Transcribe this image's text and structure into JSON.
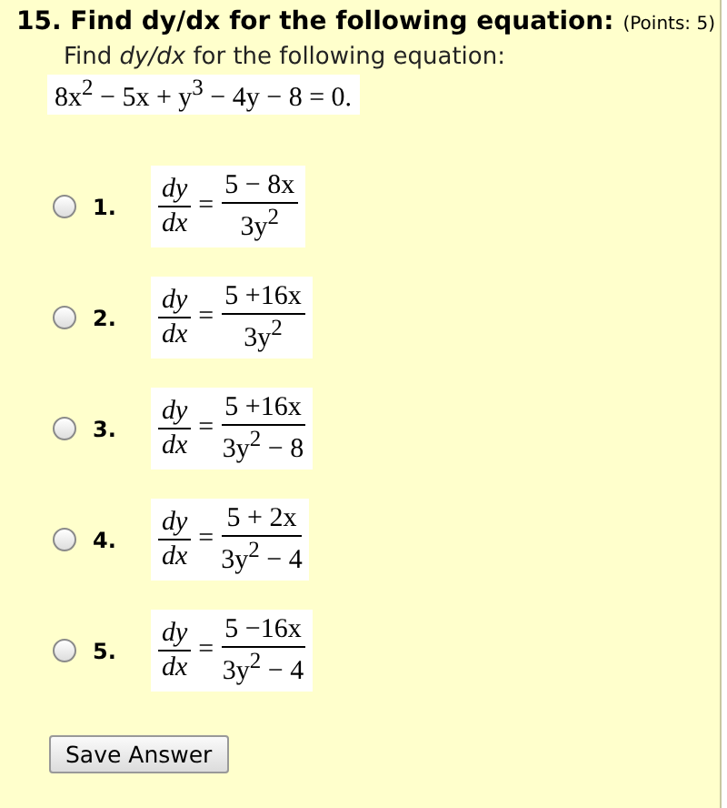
{
  "question": {
    "number": "15.",
    "title": "Find dy/dx for the following equation:",
    "points": "(Points: 5)",
    "prompt": "Find *dy/dx* for the following equation:",
    "equation": "8x$^{2}$ − 5x + y$^{3}$ − 4y − 8 = 0."
  },
  "options": [
    {
      "label": "1.",
      "selected": false,
      "lhs_top": "dy",
      "lhs_bottom": "dx",
      "equals": "=",
      "numerator": "5 − 8x",
      "denominator": "3y$^{2}$"
    },
    {
      "label": "2.",
      "selected": false,
      "lhs_top": "dy",
      "lhs_bottom": "dx",
      "equals": "=",
      "numerator": "5 +16x",
      "denominator": "3y$^{2}$"
    },
    {
      "label": "3.",
      "selected": false,
      "lhs_top": "dy",
      "lhs_bottom": "dx",
      "equals": "=",
      "numerator": "5 +16x",
      "denominator": "3y$^{2}$ − 8"
    },
    {
      "label": "4.",
      "selected": false,
      "lhs_top": "dy",
      "lhs_bottom": "dx",
      "equals": "=",
      "numerator": "5 + 2x",
      "denominator": "3y$^{2}$ − 4"
    },
    {
      "label": "5.",
      "selected": false,
      "lhs_top": "dy",
      "lhs_bottom": "dx",
      "equals": "=",
      "numerator": "5 −16x",
      "denominator": "3y$^{2}$ − 4"
    }
  ],
  "save_button": "Save Answer"
}
